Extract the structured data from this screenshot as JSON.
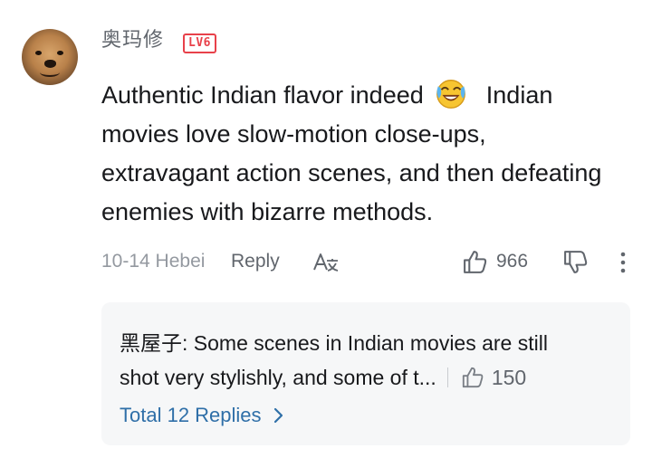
{
  "comment": {
    "username": "奥玛修",
    "level_badge": "LV6",
    "text_part1": "Authentic Indian flavor indeed",
    "emoji": "laughing-crying-emoji",
    "text_part2": "Indian movies love slow-motion close-ups, extravagant action scenes, and then defeating enemies with bizarre methods.",
    "date_location": "10-14 Hebei",
    "reply_label": "Reply",
    "like_count": "966"
  },
  "reply_preview": {
    "line1": "黑屋子: Some scenes in Indian movies are still",
    "line2": "shot very stylishly, and some of t...",
    "like_count": "150",
    "total_replies_label": "Total 12 Replies"
  },
  "colors": {
    "level_badge": "#e8414a",
    "link": "#2f6fa8",
    "reply_bg": "#f6f7f8",
    "muted_text": "#9499a0"
  }
}
